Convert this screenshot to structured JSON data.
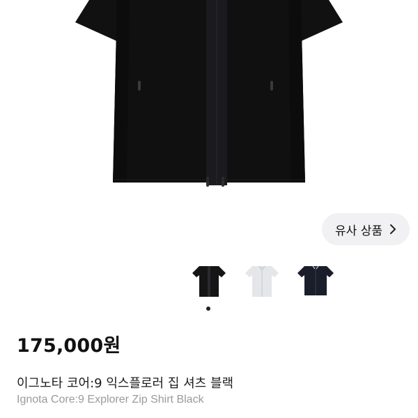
{
  "product": {
    "similar_button_label": "유사 상품",
    "price": "175,000원",
    "title_korean": "이그노타 코어:9 익스플로러 집 셔츠 블랙",
    "title_english": "Ignota Core:9 Explorer Zip Shirt Black"
  },
  "gallery": {
    "thumbnails": [
      {
        "color": "#151515"
      },
      {
        "color": "#e4e6e9"
      },
      {
        "color": "#1a1d2a"
      }
    ],
    "active_index": 0
  },
  "colors": {
    "shirt_main": "#111111",
    "zipper_panel": "#1a1a1d",
    "button_bg": "#f1f1f3"
  }
}
